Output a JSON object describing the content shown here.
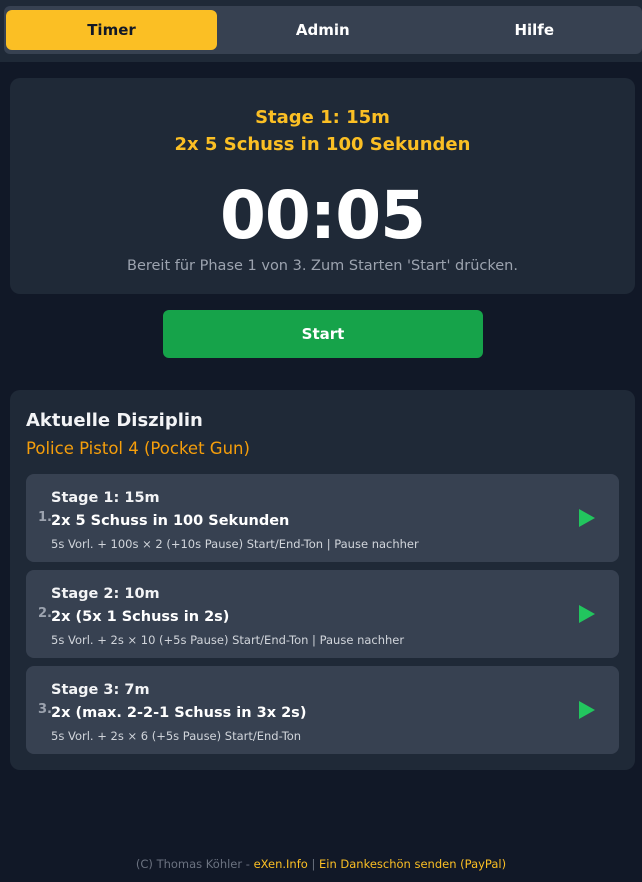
{
  "tabs": [
    {
      "label": "Timer",
      "active": true
    },
    {
      "label": "Admin",
      "active": false
    },
    {
      "label": "Hilfe",
      "active": false
    }
  ],
  "timer": {
    "stage_title": "Stage 1: 15m",
    "stage_subtitle": "2x 5 Schuss in 100 Sekunden",
    "clock": "00:05",
    "status": "Bereit für Phase 1 von 3. Zum Starten 'Start' drücken."
  },
  "start_label": "Start",
  "discipline": {
    "heading": "Aktuelle Disziplin",
    "name": "Police Pistol 4 (Pocket Gun)",
    "stages": [
      {
        "num": "1.",
        "title": "Stage 1: 15m",
        "desc": "2x 5 Schuss in 100 Sekunden",
        "details": "5s Vorl. + 100s × 2 (+10s Pause) Start/End-Ton | Pause nachher",
        "icon": "play-icon"
      },
      {
        "num": "2.",
        "title": "Stage 2: 10m",
        "desc": "2x (5x 1 Schuss in 2s)",
        "details": "5s Vorl. + 2s × 10 (+5s Pause) Start/End-Ton | Pause nachher",
        "icon": "play-icon"
      },
      {
        "num": "3.",
        "title": "Stage 3: 7m",
        "desc": "2x (max. 2-2-1 Schuss in 3x 2s)",
        "details": "5s Vorl. + 2s × 6 (+5s Pause) Start/End-Ton",
        "icon": "play-icon"
      }
    ]
  },
  "footer": {
    "copyright": "(C) Thomas Köhler - ",
    "site_link": "eXen.Info",
    "separator": " | ",
    "donate_link": "Ein Dankeschön senden (PayPal)"
  },
  "colors": {
    "accent": "#fbbf24",
    "start": "#16a34a",
    "play": "#22c55e",
    "discipline_name": "#f59e0b"
  }
}
